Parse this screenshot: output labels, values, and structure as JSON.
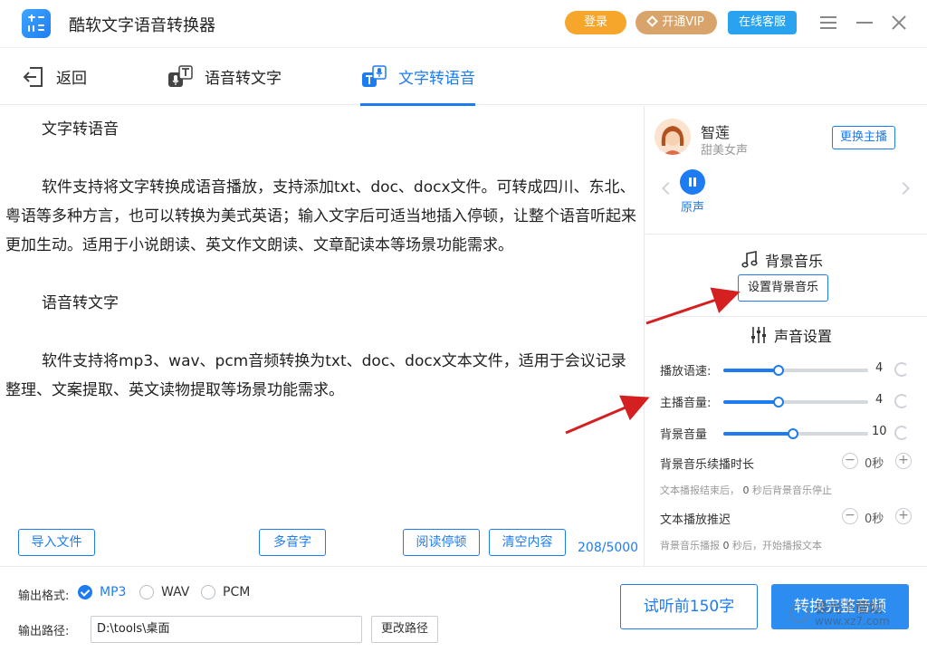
{
  "app": {
    "title": "酷软文字语音转换器",
    "login": "登录",
    "vip": "开通VIP",
    "service": "在线客服"
  },
  "nav": {
    "back": "返回",
    "tab_speech_to_text": "语音转文字",
    "tab_text_to_speech": "文字转语音",
    "active_tab": "文字转语音"
  },
  "editor": {
    "paragraphs": [
      "文字转语音",
      "",
      "软件支持将文字转换成语音播放，支持添加txt、doc、docx文件。可转成四川、东北、粤语等多种方言，也可以转换为美式英语；输入文字后可适当地插入停顿，让整个语音听起来更加生动。适用于小说朗读、英文作文朗读、文章配读本等场景功能需求。",
      "",
      "语音转文字",
      "",
      "软件支持将mp3、wav、pcm音频转换为txt、doc、docx文本文件，适用于会议记录整理、文案提取、英文读物提取等场景功能需求。"
    ],
    "import_file": "导入文件",
    "polyphone": "多音字",
    "read_pause": "阅读停顿",
    "clear": "清空内容",
    "char_count": "208/5000"
  },
  "voice": {
    "name": "智莲",
    "desc": "甜美女声",
    "switch": "更换主播",
    "play_label": "原声"
  },
  "bgm": {
    "title": "背景音乐",
    "set_button": "设置背景音乐"
  },
  "sound": {
    "title": "声音设置",
    "rows": [
      {
        "label": "播放语速:",
        "value": "4",
        "level": 0.38
      },
      {
        "label": "主播音量:",
        "value": "4",
        "level": 0.38
      },
      {
        "label": "背景音量",
        "value": "10",
        "level": 0.48
      }
    ],
    "bgm_duration_label": "背景音乐续播时长",
    "bgm_duration_value": "0秒",
    "bgm_duration_hint_pre": "文本播报结束后，",
    "bgm_duration_hint_num": "0",
    "bgm_duration_hint_post": "秒后背景音乐停止",
    "text_delay_label": "文本播放推迟",
    "text_delay_value": "0秒",
    "text_delay_hint_pre": "背景音乐播报",
    "text_delay_hint_num": "0",
    "text_delay_hint_post": "秒后，开始播报文本",
    "minus": "−",
    "plus": "+"
  },
  "output": {
    "format_label": "输出格式:",
    "formats": [
      "MP3",
      "WAV",
      "PCM"
    ],
    "selected_format": "MP3",
    "path_label": "输出路径:",
    "path_value": "D:\\tools\\桌面",
    "change_path": "更改路径"
  },
  "actions": {
    "preview": "试听前150字",
    "convert": "转换完整音频"
  },
  "watermark": {
    "line1": "极光下载站",
    "line2": "www.xz7.com"
  },
  "colors": {
    "accent": "#1e7cf2",
    "login": "#f6a62b",
    "vip": "#d9a46b",
    "service": "#29a3f0",
    "annotation_arrow": "#d42020"
  }
}
